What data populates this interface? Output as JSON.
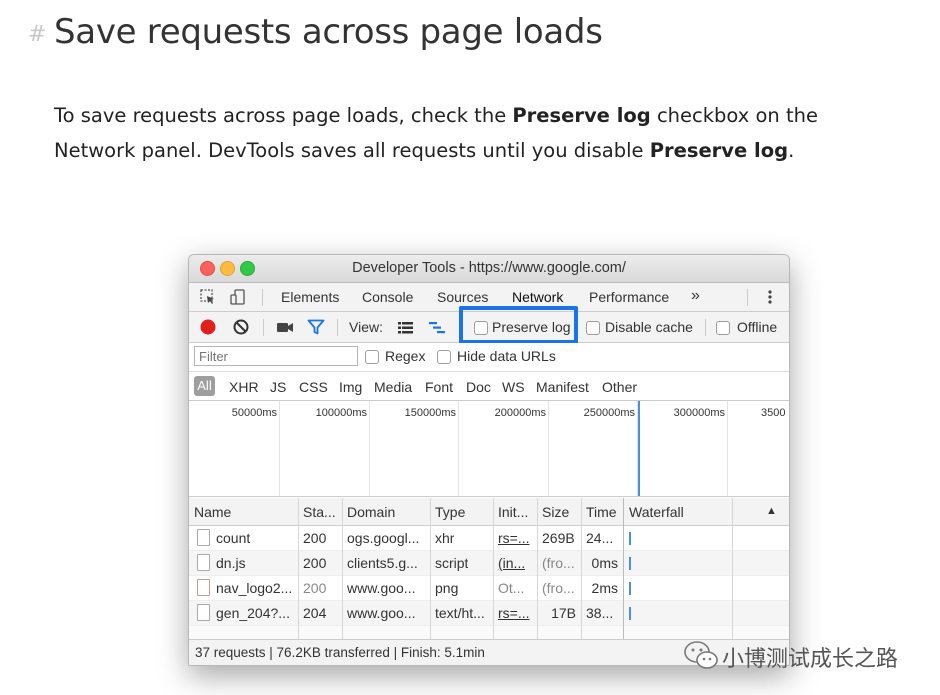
{
  "heading": {
    "hash": "#",
    "title": "Save requests across page loads"
  },
  "para": {
    "p1": "To save requests across page loads, check the ",
    "b1": "Preserve log",
    "p2": " checkbox on the Network panel. DevTools saves all requests until you disable ",
    "b2": "Preserve log",
    "p3": "."
  },
  "devtools": {
    "window_title": "Developer Tools - https://www.google.com/",
    "tabs": [
      "Elements",
      "Console",
      "Sources",
      "Network",
      "Performance",
      "»"
    ],
    "active_tab": "Network",
    "toolbar": {
      "view_label": "View:",
      "preserve_log": "Preserve log",
      "disable_cache": "Disable cache",
      "offline": "Offline"
    },
    "filter": {
      "placeholder": "Filter",
      "regex": "Regex",
      "hide_data_urls": "Hide data URLs"
    },
    "types": [
      "All",
      "XHR",
      "JS",
      "CSS",
      "Img",
      "Media",
      "Font",
      "Doc",
      "WS",
      "Manifest",
      "Other"
    ],
    "timeline_ticks": [
      "50000ms",
      "100000ms",
      "150000ms",
      "200000ms",
      "250000ms",
      "300000ms",
      "3500"
    ],
    "columns": [
      "Name",
      "Sta...",
      "Domain",
      "Type",
      "Init...",
      "Size",
      "Time",
      "Waterfall"
    ],
    "rows": [
      {
        "name": "count",
        "status": "200",
        "domain": "ogs.googl...",
        "type": "xhr",
        "initiator": "rs=...",
        "size": "269B",
        "time": "24..."
      },
      {
        "name": "dn.js",
        "status": "200",
        "domain": "clients5.g...",
        "type": "script",
        "initiator": "(in...",
        "size": "(fro...",
        "time": "0ms"
      },
      {
        "name": "nav_logo2...",
        "status": "200",
        "domain": "www.goo...",
        "type": "png",
        "initiator": "Ot...",
        "size": "(fro...",
        "time": "2ms"
      },
      {
        "name": "gen_204?...",
        "status": "204",
        "domain": "www.goo...",
        "type": "text/ht...",
        "initiator": "rs=...",
        "size": "17B",
        "time": "38..."
      }
    ],
    "status_bar": "37 requests | 76.2KB transferred | Finish: 5.1min"
  },
  "watermark": {
    "text": "小博测试成长之路"
  },
  "colors": {
    "highlight": "#1a73e8",
    "record": "#e0201c",
    "filter_icon": "#1a73e8"
  }
}
